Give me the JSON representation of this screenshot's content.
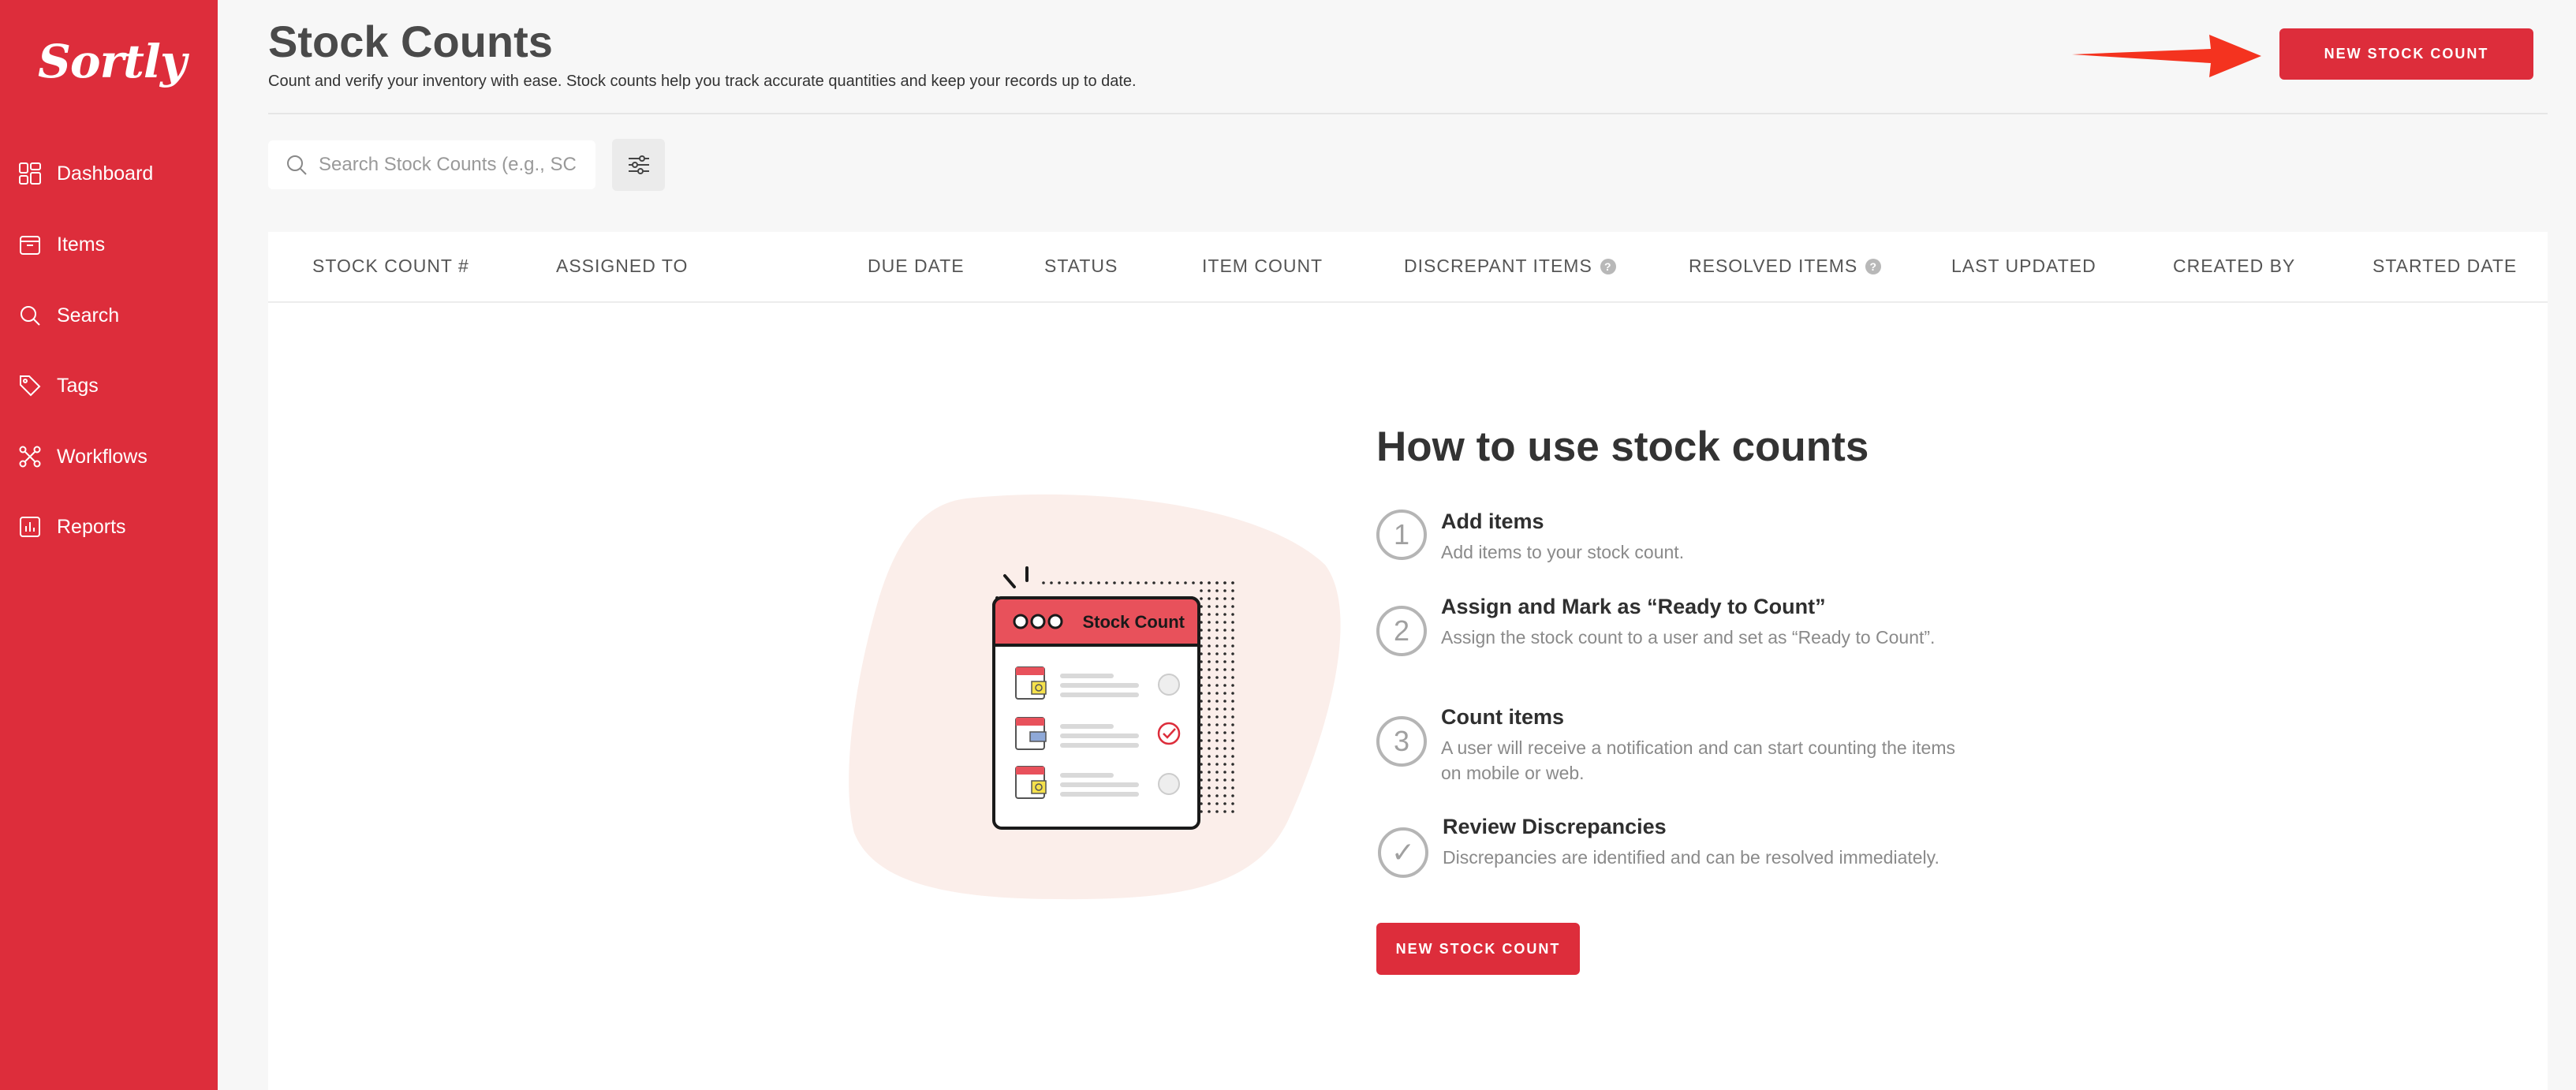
{
  "app": {
    "logo_text": "Sortly"
  },
  "sidebar": {
    "items": [
      {
        "label": "Dashboard",
        "icon": "dashboard-icon"
      },
      {
        "label": "Items",
        "icon": "items-icon"
      },
      {
        "label": "Search",
        "icon": "search-icon"
      },
      {
        "label": "Tags",
        "icon": "tag-icon"
      },
      {
        "label": "Workflows",
        "icon": "workflows-icon"
      },
      {
        "label": "Reports",
        "icon": "reports-icon"
      }
    ]
  },
  "header": {
    "title": "Stock Counts",
    "subtitle": "Count and verify your inventory with ease. Stock counts help you track accurate quantities and keep your records up to date.",
    "new_button_label": "NEW STOCK COUNT"
  },
  "search": {
    "placeholder": "Search Stock Counts (e.g., SC",
    "value": ""
  },
  "table": {
    "columns": [
      "STOCK COUNT #",
      "ASSIGNED TO",
      "DUE DATE",
      "STATUS",
      "ITEM COUNT",
      "DISCREPANT ITEMS",
      "RESOLVED ITEMS",
      "LAST UPDATED",
      "CREATED BY",
      "STARTED DATE"
    ],
    "help_icon_text": "?"
  },
  "empty_state": {
    "illustration_title": "Stock Count",
    "title": "How to use stock counts",
    "steps": [
      {
        "number": "1",
        "title": "Add items",
        "description": "Add items to your stock count."
      },
      {
        "number": "2",
        "title": "Assign and Mark as “Ready to Count”",
        "description": "Assign the stock count to a user and set as “Ready to Count”."
      },
      {
        "number": "3",
        "title": "Count items",
        "description": "A user will receive a notification and can start counting the items on mobile or web."
      },
      {
        "number": "✓",
        "title": "Review Discrepancies",
        "description": "Discrepancies are identified and can be resolved immediately."
      }
    ],
    "cta_label": "NEW STOCK COUNT"
  },
  "colors": {
    "brand": "#dd2d3b",
    "arrow": "#f4331f",
    "blob": "#fbeeea"
  }
}
